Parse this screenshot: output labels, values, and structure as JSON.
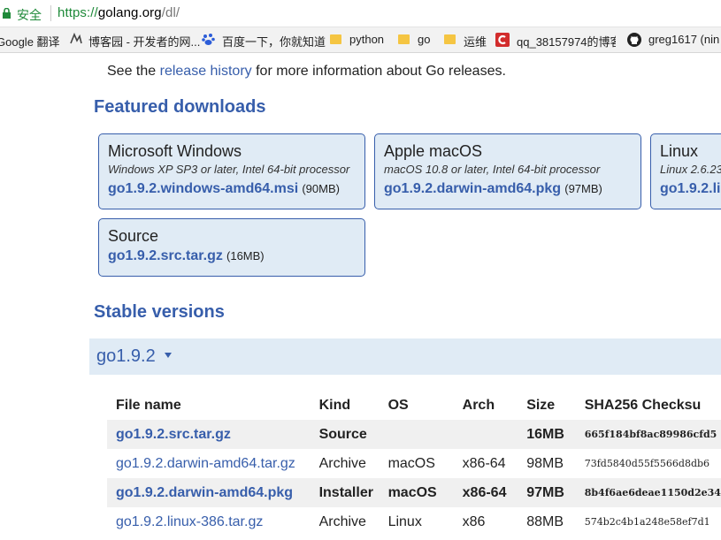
{
  "browser": {
    "secure_label": "安全",
    "url_scheme": "https://",
    "url_host": "golang.org",
    "url_path": "/dl/"
  },
  "bookmarks": [
    {
      "label": "Google 翻译",
      "icon": "google-icon"
    },
    {
      "label": "博客园 - 开发者的网...",
      "icon": "cnblogs-icon"
    },
    {
      "label": "百度一下，你就知道",
      "icon": "baidu-icon"
    },
    {
      "label": "python",
      "icon": "folder-icon"
    },
    {
      "label": "go",
      "icon": "folder-icon"
    },
    {
      "label": "运维",
      "icon": "folder-icon"
    },
    {
      "label": "qq_38157974的博客",
      "icon": "csdn-icon"
    },
    {
      "label": "greg1617 (nin",
      "icon": "github-icon"
    }
  ],
  "intro": {
    "before": "See the ",
    "link": "release history",
    "after": " for more information about Go releases."
  },
  "featured": {
    "heading": "Featured downloads",
    "cards": [
      {
        "title": "Microsoft Windows",
        "desc": "Windows XP SP3 or later, Intel 64-bit processor",
        "file": "go1.9.2.windows-amd64.msi",
        "size": "(90MB)"
      },
      {
        "title": "Apple macOS",
        "desc": "macOS 10.8 or later, Intel 64-bit processor",
        "file": "go1.9.2.darwin-amd64.pkg",
        "size": "(97MB)"
      },
      {
        "title": "Linux",
        "desc": "Linux 2.6.23",
        "file": "go1.9.2.li",
        "size": ""
      },
      {
        "title": "Source",
        "desc": "",
        "file": "go1.9.2.src.tar.gz",
        "size": "(16MB)"
      }
    ]
  },
  "stable": {
    "heading": "Stable versions",
    "version": "go1.9.2",
    "columns": {
      "file": "File name",
      "kind": "Kind",
      "os": "OS",
      "arch": "Arch",
      "size": "Size",
      "sha": "SHA256 Checksu"
    },
    "rows": [
      {
        "file": "go1.9.2.src.tar.gz",
        "kind": "Source",
        "os": "",
        "arch": "",
        "size": "16MB",
        "sha": "665f184bf8ac89986cfd5",
        "highlight": true
      },
      {
        "file": "go1.9.2.darwin-amd64.tar.gz",
        "kind": "Archive",
        "os": "macOS",
        "arch": "x86-64",
        "size": "98MB",
        "sha": "73fd5840d55f5566d8db6",
        "highlight": false
      },
      {
        "file": "go1.9.2.darwin-amd64.pkg",
        "kind": "Installer",
        "os": "macOS",
        "arch": "x86-64",
        "size": "97MB",
        "sha": "8b4f6ae6deae1150d2e34",
        "highlight": true
      },
      {
        "file": "go1.9.2.linux-386.tar.gz",
        "kind": "Archive",
        "os": "Linux",
        "arch": "x86",
        "size": "88MB",
        "sha": "574b2c4b1a248e58ef7d1",
        "highlight": false
      }
    ]
  },
  "colors": {
    "link": "#375eab",
    "card_bg": "#e0ebf5",
    "secure": "#1f8a3a"
  }
}
